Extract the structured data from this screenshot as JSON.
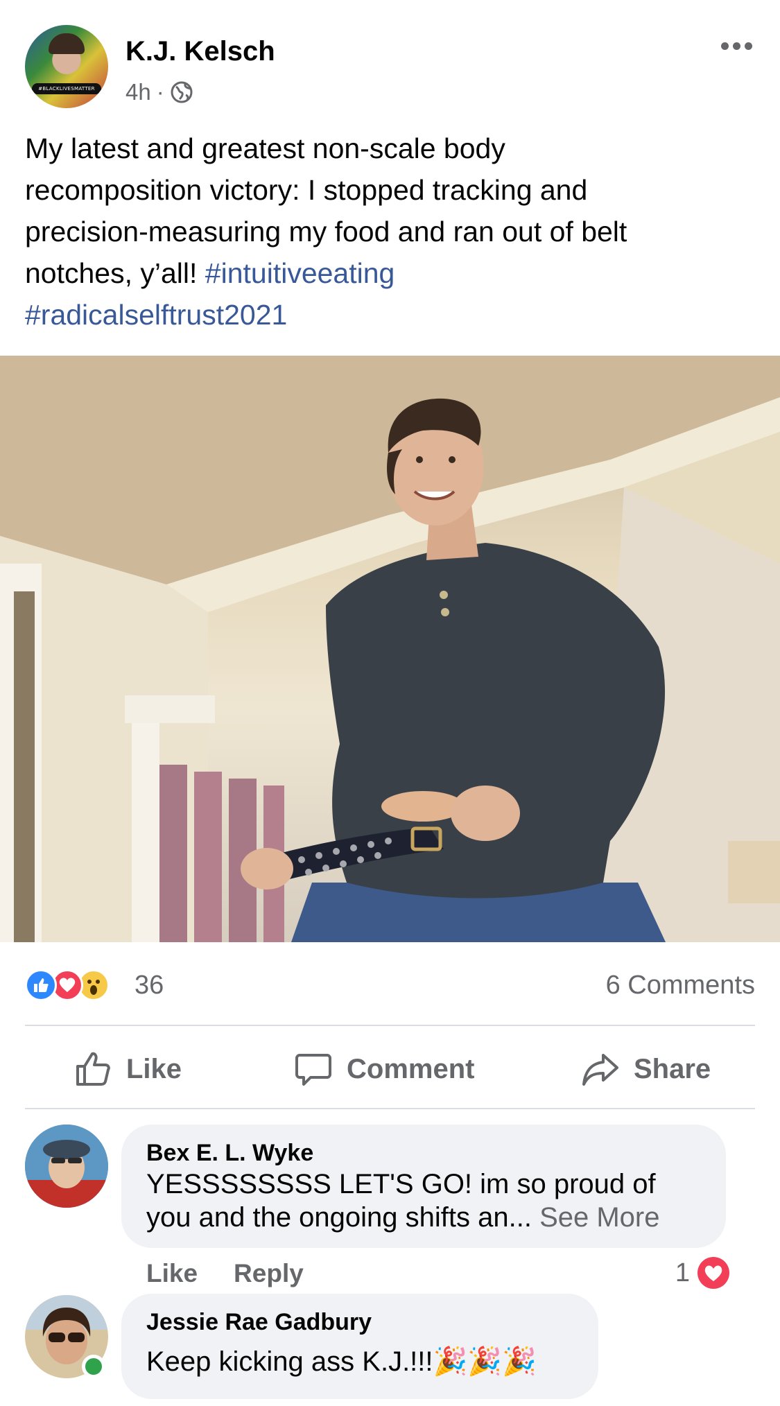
{
  "post": {
    "author": "K.J. Kelsch",
    "time": "4h",
    "separator": "·",
    "avatar_badge": "#BLACKLIVESMATTER",
    "text_lines": [
      "My latest and greatest non-scale body",
      "recomposition victory: I stopped tracking and",
      "precision-measuring my food and ran out of belt"
    ],
    "text_last_prefix": "notches, y’all! ",
    "hashtag_1": "#intuitiveeating",
    "hashtag_2": "#radicalselftrust2021"
  },
  "reactions": {
    "count": "36",
    "comments": "6 Comments",
    "types": [
      "like-icon",
      "love-icon",
      "wow-icon"
    ]
  },
  "actions": {
    "like": "Like",
    "comment": "Comment",
    "share": "Share"
  },
  "comments": [
    {
      "name": "Bex E. L. Wyke",
      "text_line_1": "YESSSSSSSS LET'S GO! im so proud of",
      "text_line_2": "you and the ongoing shifts an... ",
      "see_more": "See More",
      "like": "Like",
      "reply": "Reply",
      "reaction_count": "1"
    },
    {
      "name": "Jessie Rae Gadbury",
      "text": "Keep kicking ass K.J.!!!🎉🎉🎉"
    }
  ],
  "colors": {
    "accent_blue": "#385898",
    "like_blue": "#2d88ff",
    "love_red": "#f33e58",
    "wow_yellow": "#f7c948",
    "secondary_text": "#65676b",
    "online_green": "#31a24c"
  }
}
